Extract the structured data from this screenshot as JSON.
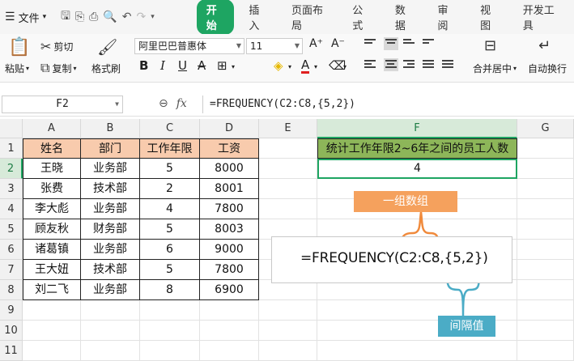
{
  "menubar": {
    "file_label": "文件",
    "tabs": [
      "开始",
      "插入",
      "页面布局",
      "公式",
      "数据",
      "审阅",
      "视图",
      "开发工具"
    ],
    "active_tab": 0
  },
  "ribbon": {
    "paste_label": "粘贴",
    "cut_label": "剪切",
    "copy_label": "复制",
    "format_painter_label": "格式刷",
    "font_name": "阿里巴巴普惠体",
    "font_size": "11",
    "merge_center_label": "合并居中",
    "wrap_text_label": "自动换行"
  },
  "formula_bar": {
    "name_box": "F2",
    "formula": "=FREQUENCY(C2:C8,{5,2})"
  },
  "sheet": {
    "columns": [
      "A",
      "B",
      "C",
      "D",
      "E",
      "F",
      "G"
    ],
    "rows": [
      "1",
      "2",
      "3",
      "4",
      "5",
      "6",
      "7",
      "8",
      "9",
      "10",
      "11"
    ],
    "table_header": [
      "姓名",
      "部门",
      "工作年限",
      "工资"
    ],
    "table_rows": [
      [
        "王晓",
        "业务部",
        "5",
        "8000"
      ],
      [
        "张费",
        "技术部",
        "2",
        "8001"
      ],
      [
        "李大彪",
        "业务部",
        "4",
        "7800"
      ],
      [
        "顾友秋",
        "财务部",
        "5",
        "8003"
      ],
      [
        "诸葛镇",
        "业务部",
        "6",
        "9000"
      ],
      [
        "王大妞",
        "技术部",
        "5",
        "7800"
      ],
      [
        "刘二飞",
        "业务部",
        "8",
        "6900"
      ]
    ],
    "f1": "统计工作年限2~6年之间的员工人数",
    "f2": "4"
  },
  "annotations": {
    "array_label": "一组数组",
    "formula_display": "=FREQUENCY(C2:C8,{5,2})",
    "interval_label": "间隔值"
  },
  "colors": {
    "accent_green": "#1ea562",
    "header_fill": "#f8cbad",
    "title_fill": "#8db659",
    "orange_callout": "#f5a15d",
    "blue_callout": "#4bacc6"
  }
}
